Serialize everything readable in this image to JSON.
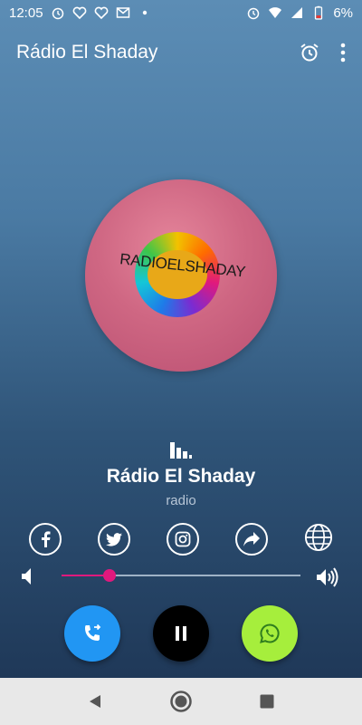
{
  "status_bar": {
    "time": "12:05",
    "battery": "6%",
    "icons": [
      "alarm-icon",
      "heart-icon",
      "heart-icon",
      "gmail-icon",
      "dot-icon",
      "alarm-icon",
      "wifi-icon",
      "signal-icon",
      "battery-icon"
    ]
  },
  "app_bar": {
    "title": "Rádio El Shaday",
    "actions": [
      "alarm-clock-icon",
      "more-vert-icon"
    ]
  },
  "artwork": {
    "label_text": "RADIOELSHADAY"
  },
  "station": {
    "name": "Rádio El Shaday",
    "subtitle": "radio"
  },
  "social": [
    "facebook-icon",
    "twitter-icon",
    "instagram-icon",
    "share-icon",
    "website-icon"
  ],
  "volume": {
    "level_fraction": 0.2,
    "accent": "#e0197d"
  },
  "controls": {
    "call_color": "#2196f3",
    "pause_color": "#000000",
    "whatsapp_color": "#a6ee3c"
  },
  "nav": [
    "back-icon",
    "home-icon",
    "recents-icon"
  ]
}
